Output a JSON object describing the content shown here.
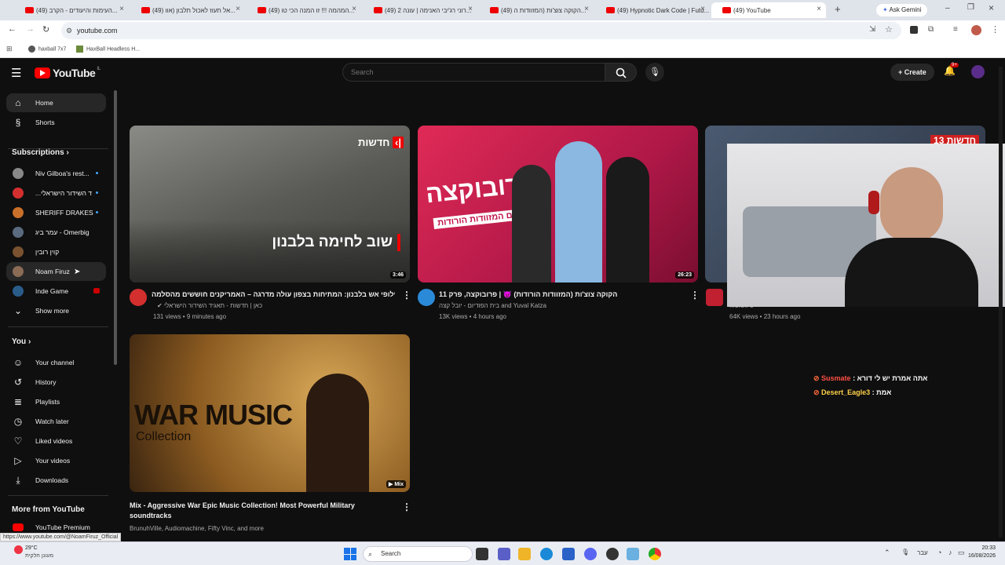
{
  "browser": {
    "tabs": [
      {
        "label": "(49) העימות והיעודים - הקרב..."
      },
      {
        "label": "(49) אל תעוז לאכול תלבון (אוו..."
      },
      {
        "label": "(49) המהמה !!! זו המנה הכי טו..."
      },
      {
        "label": "(49) רוני רג'יבי האנימה | עונה 2..."
      },
      {
        "label": "(49) הקוקה צוצ'ות (המזוודות ה..."
      },
      {
        "label": "(49) Hypnotic Dark Code | Futu..."
      },
      {
        "label": "(49) YouTube"
      }
    ],
    "gemini_label": "Ask Gemini",
    "url": "youtube.com",
    "bookmarks": [
      {
        "label": "haxball 7x7"
      },
      {
        "label": "HaxBall Headless H..."
      }
    ],
    "status_url": "https://www.youtube.com/@NoamFiruz_Official"
  },
  "header": {
    "logo": "YouTube",
    "country_code": "IL",
    "search_placeholder": "Search",
    "create_label": "Create",
    "notification_count": "9+"
  },
  "sidebar": {
    "main": [
      {
        "label": "Home",
        "icon": "home-icon"
      },
      {
        "label": "Shorts",
        "icon": "shorts-icon"
      }
    ],
    "subscriptions_heading": "Subscriptions",
    "subscriptions": [
      {
        "label": "Niv Gilboa's rest...",
        "color": "#888888"
      },
      {
        "label": "...ד השידור הישראלי",
        "color": "#d32f2f"
      },
      {
        "label": "SHERIFF DRAKES",
        "color": "#c9702a"
      },
      {
        "label": "עמר ביג - Omerbig",
        "color": "#5a6b80"
      },
      {
        "label": "קוין רובין",
        "color": "#7a5230"
      },
      {
        "label": "Noam Firuz",
        "color": "#8a6b55"
      },
      {
        "label": "Inde Game",
        "color": "#2a5c8a"
      }
    ],
    "show_more": "Show more",
    "you_heading": "You",
    "you_items": [
      {
        "label": "Your channel",
        "icon": "channel-icon"
      },
      {
        "label": "History",
        "icon": "history-icon"
      },
      {
        "label": "Playlists",
        "icon": "playlists-icon"
      },
      {
        "label": "Watch later",
        "icon": "watch-later-icon"
      },
      {
        "label": "Liked videos",
        "icon": "like-icon"
      },
      {
        "label": "Your videos",
        "icon": "your-videos-icon"
      },
      {
        "label": "Downloads",
        "icon": "download-icon"
      }
    ],
    "more_heading": "More from YouTube",
    "premium_label": "YouTube Premium"
  },
  "videos": [
    {
      "thumb_text": "שוב לחימה בלבנון",
      "thumb_badge": "חדשות",
      "duration": "3:46",
      "title": "חילופי אש בלבנון: המתיחות בצפון עולה מדרגה – האמריקנים חוששים מהסלמה",
      "channel": "כאן | חדשות - תאגיד השידור הישראלי",
      "meta": "131 views • 9 minutes ago"
    },
    {
      "thumb_text": "פרובוקצה",
      "thumb_sub": "עם המזוודות הורודות!",
      "duration": "26:23",
      "title": "הקוקה צוצ'ות (המזוודות הורודות) 😈 | פרובוקצה, פרק 11",
      "channel": "בית הפודיום - יובל קצה and Yuval Katza",
      "meta": "13K views • 4 hours ago"
    },
    {
      "thumb_badge": "חדשות 13",
      "channel": "...ט ווטוט",
      "meta": "64K views • 23 hours ago"
    },
    {
      "thumb_text_big": "WAR MUSIC",
      "thumb_text_small": "Collection",
      "duration": "Mix",
      "title_line1": "Mix - Aggressive War Epic Music Collection! Most Powerful Military",
      "title_line2": "soundtracks",
      "meta": "BrunuhVille, Audiomachine, Fifty Vinc, and more"
    }
  ],
  "chat": [
    {
      "user": "Susmate",
      "text": ": אתה אמרת יש לי דורא",
      "color": "#ff4e45"
    },
    {
      "user": "Desert_Eagle3",
      "text": ": אמת",
      "color": "#ffd24a"
    }
  ],
  "taskbar": {
    "weather_temp": "29°C",
    "weather_text": "מעונן חלקית",
    "search_label": "Search",
    "lang": "עבר",
    "time": "20:33",
    "date": "16/08/2026"
  }
}
